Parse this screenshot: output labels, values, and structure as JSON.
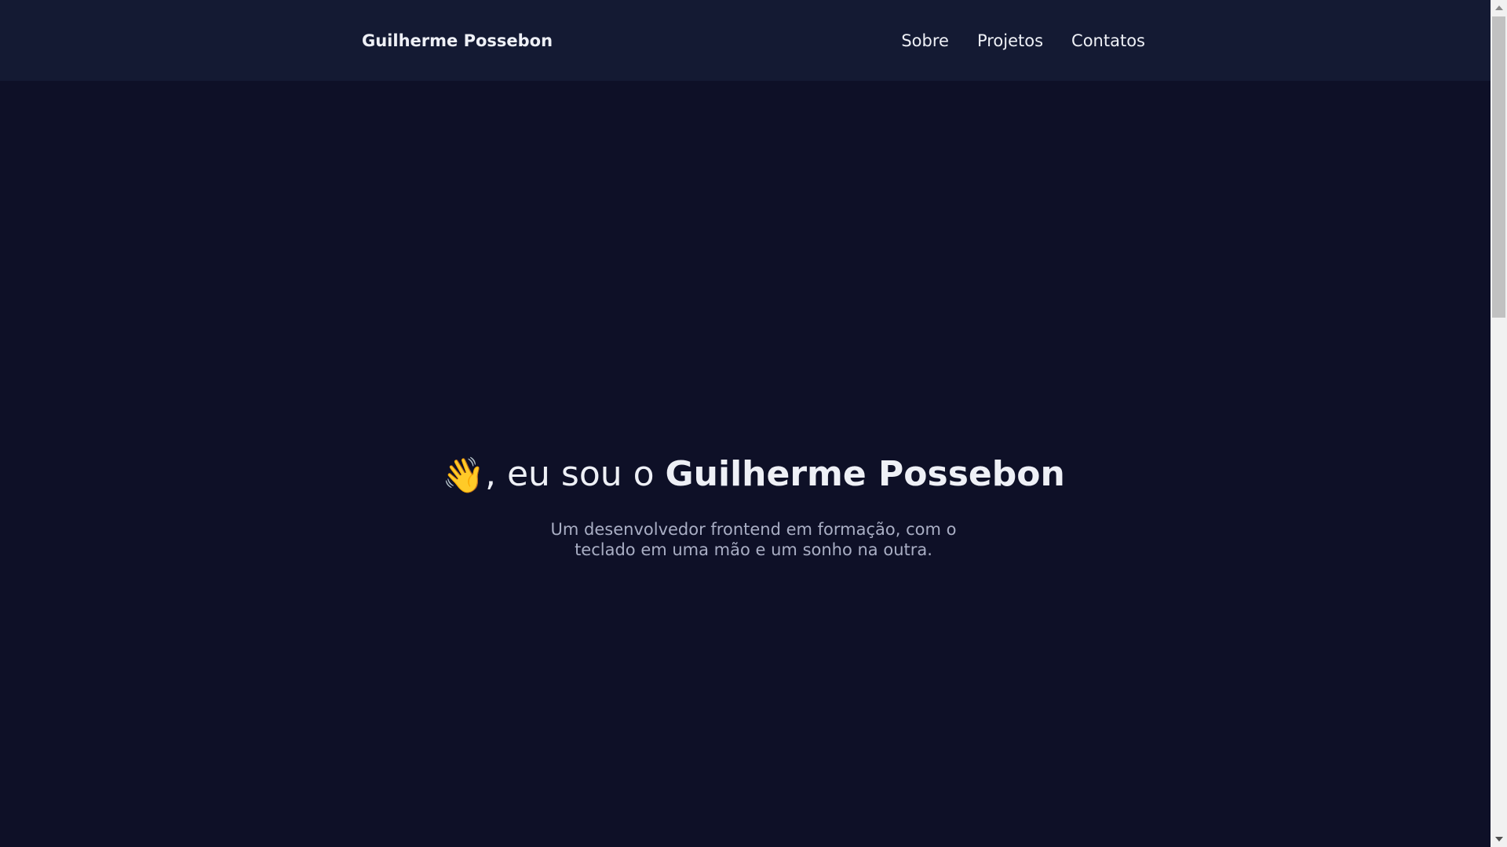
{
  "navbar": {
    "brand": "Guilherme Possebon",
    "links": [
      {
        "label": "Sobre"
      },
      {
        "label": "Projetos"
      },
      {
        "label": "Contatos"
      }
    ]
  },
  "hero": {
    "wave_icon": "👋",
    "title_prefix": ", eu sou o ",
    "title_name": "Guilherme Possebon",
    "subtitle": "Um desenvolvedor frontend em formação, com o teclado em uma mão e um sonho na outra."
  },
  "colors": {
    "page_background": "#0e1027",
    "navbar_background": "#141a33",
    "text_primary": "#eef0f6",
    "text_secondary": "#a9aec4"
  },
  "scrollbar": {
    "scroll_position": 0
  }
}
